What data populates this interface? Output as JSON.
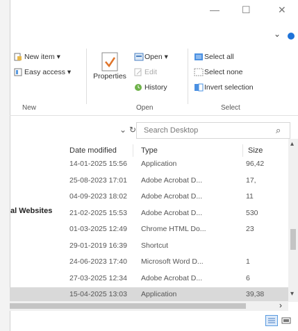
{
  "window": {
    "minimize_glyph": "—",
    "maximize_glyph": "☐",
    "close_glyph": "✕",
    "chevron_glyph": "⌄"
  },
  "ribbon": {
    "new_item": "New item ▾",
    "easy_access": "Easy access ▾",
    "new_group": "New",
    "properties": "Properties",
    "open": "Open ▾",
    "edit": "Edit",
    "history": "History",
    "open_group": "Open",
    "select_all": "Select all",
    "select_none": "Select none",
    "invert_selection": "Invert selection",
    "select_group": "Select"
  },
  "address": {
    "dropdown_glyph": "⌄",
    "refresh_glyph": "↻",
    "search_placeholder": "Search Desktop",
    "search_glyph": "⌕"
  },
  "columns": {
    "date_modified": "Date modified",
    "type": "Type",
    "size": "Size"
  },
  "nav_fragment": "al Websites",
  "rows": [
    {
      "date": "14-01-2025 15:56",
      "type": "Application",
      "size": "96,42"
    },
    {
      "date": "25-08-2023 17:01",
      "type": "Adobe Acrobat D...",
      "size": "17,"
    },
    {
      "date": "04-09-2023 18:02",
      "type": "Adobe Acrobat D...",
      "size": "11"
    },
    {
      "date": "21-02-2025 15:53",
      "type": "Adobe Acrobat D...",
      "size": "530"
    },
    {
      "date": "01-03-2025 12:49",
      "type": "Chrome HTML Do...",
      "size": "23"
    },
    {
      "date": "29-01-2019 16:39",
      "type": "Shortcut",
      "size": ""
    },
    {
      "date": "24-06-2023 17:40",
      "type": "Microsoft Word D...",
      "size": "1"
    },
    {
      "date": "27-03-2025 12:34",
      "type": "Adobe Acrobat D...",
      "size": "6"
    },
    {
      "date": "15-04-2025 13:03",
      "type": "Application",
      "size": "39,38"
    }
  ],
  "selected_row_index": 8,
  "scroll": {
    "up": "▴",
    "down": "▾",
    "right": "›"
  },
  "colors": {
    "selection": "#d9d9d9",
    "accent": "#1e73d8"
  }
}
